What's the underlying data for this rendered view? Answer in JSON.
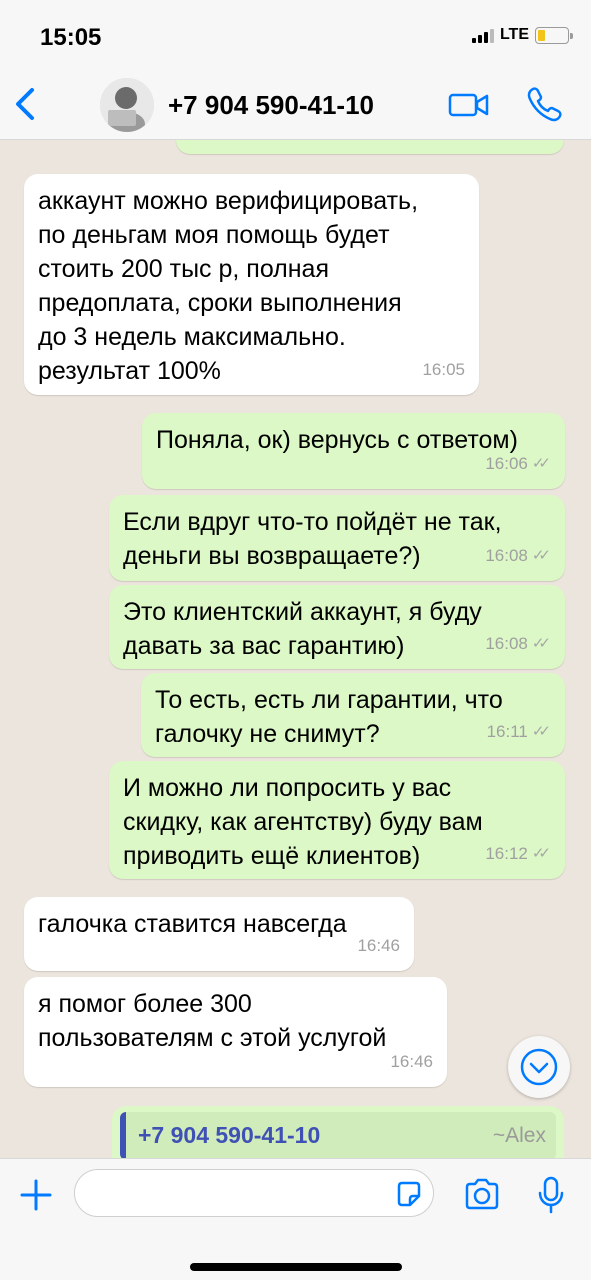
{
  "status_bar": {
    "time": "15:05",
    "network": "LTE",
    "battery_level": 0.25
  },
  "header": {
    "contact": "+7 904 590-41-10"
  },
  "messages": [
    {
      "dir": "in",
      "text": "аккаунт можно верифицировать,\nпо деньгам моя помощь будет\nстоить 200 тыс р, полная\nпредоплата, сроки выполнения\nдо 3 недель максимально.\nрезультат 100%",
      "time": "16:05"
    },
    {
      "dir": "out",
      "text": "Поняла, ок) вернусь с ответом)",
      "time": "16:06"
    },
    {
      "dir": "out",
      "text": "Если вдруг что-то пойдёт не так,\nденьги вы возвращаете?)",
      "time": "16:08"
    },
    {
      "dir": "out",
      "text": "Это клиентский аккаунт, я буду\nдавать за вас гарантию)",
      "time": "16:08"
    },
    {
      "dir": "out",
      "text": "То есть, есть ли гарантии, что\nгалочку не снимут?",
      "time": "16:11"
    },
    {
      "dir": "out",
      "text": "И можно ли попросить у вас\nскидку, как агентству) буду вам\nприводить ещё клиентов)",
      "time": "16:12"
    },
    {
      "dir": "in",
      "text": "галочка ставится навсегда",
      "time": "16:46"
    },
    {
      "dir": "in",
      "text": "я помог более 300\nпользователям с этой услугой",
      "time": "16:46"
    }
  ],
  "quoted_contact": {
    "number": "+7 904 590-41-10",
    "alias": "~Alex"
  },
  "colors": {
    "accent": "#007aff",
    "outgoing": "#dcf8c6",
    "incoming": "#ffffff",
    "quote_bar": "#3f51b5"
  }
}
